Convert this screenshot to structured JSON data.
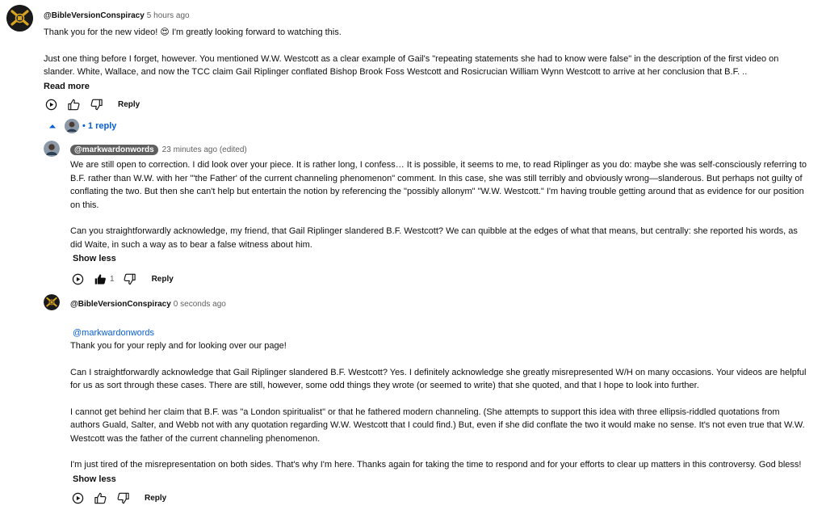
{
  "comments": [
    {
      "handle": "@BibleVersionConspiracy",
      "time": "5 hours ago",
      "para1": "Thank you for the new video! 😍 I'm greatly looking forward to watching this.",
      "para2": "Just one thing before I forget, however. You mentioned W.W. Westcott as a clear example of Gail's \"repeating statements she had to know were false\" in the description of the first video on slander. White, Wallace, and now the TCC claim Gail Riplinger conflated Bishop Brook Foss Westcott and Rosicrucian William Wynn Westcott to arrive at her conclusion that B.F. ..",
      "read_more": "Read more",
      "reply_label": "Reply",
      "replies_toggle": "• 1 reply"
    },
    {
      "handle": "@markwardonwords",
      "time": "23 minutes ago (edited)",
      "para1": "We are still open to correction. I did look over your piece. It is rather long, I confess… It is possible, it seems to me, to read Riplinger as you do: maybe she was self-consciously referring to B.F. rather than W.W. with her \"'the Father' of the current channeling phenomenon\" comment. In this case, she was still terribly and obviously wrong—slanderous. But perhaps not guilty of conflating the two. But then she can't help but entertain the notion by referencing the \"possibly allonym\" \"W.W. Westcott.\" I'm having trouble getting around that as evidence for our position on this.",
      "para2": "Can you straightforwardly acknowledge, my friend, that Gail Riplinger slandered B.F. Westcott? We can quibble at the edges of what that means, but centrally: she reported his words, as did Waite, in such a way as to bear a false witness about him.",
      "show_less": "Show less",
      "like_count": "1",
      "reply_label": "Reply"
    },
    {
      "handle": "@BibleVersionConspiracy",
      "time": "0 seconds ago",
      "mention": "@markwardonwords",
      "para1": "Thank you for your reply and for looking over our page!",
      "para2": "Can I straightforwardly acknowledge that Gail Riplinger slandered B.F. Westcott? Yes. I definitely acknowledge she greatly misrepresented W/H on many occasions. Your videos are helpful for us as sort through these cases. There are still, however, some odd things they wrote (or seemed to write) that she quoted, and that I hope to look into further.",
      "para3": "I cannot get behind her claim that B.F. was \"a London spiritualist\" or that he fathered modern channeling. (She attempts to support this idea with three ellipsis-riddled quotations from authors Guald, Salter, and Webb not with any quotation regarding W.W. Westcott that I could find.) But, even if she did conflate the two it would make no sense. It's not even true that W.W. Westcott was the father of the current channeling phenomenon.",
      "para4": "I'm just tired of the misrepresentation on both sides. That's why I'm here. Thanks again for taking the time to respond and for your efforts to clear up matters in this controversy. God bless!",
      "show_less": "Show less",
      "reply_label": "Reply"
    }
  ],
  "colors": {
    "link": "#065fd4",
    "text": "#0f0f0f",
    "muted": "#606060",
    "chip": "#5f5f5f"
  }
}
